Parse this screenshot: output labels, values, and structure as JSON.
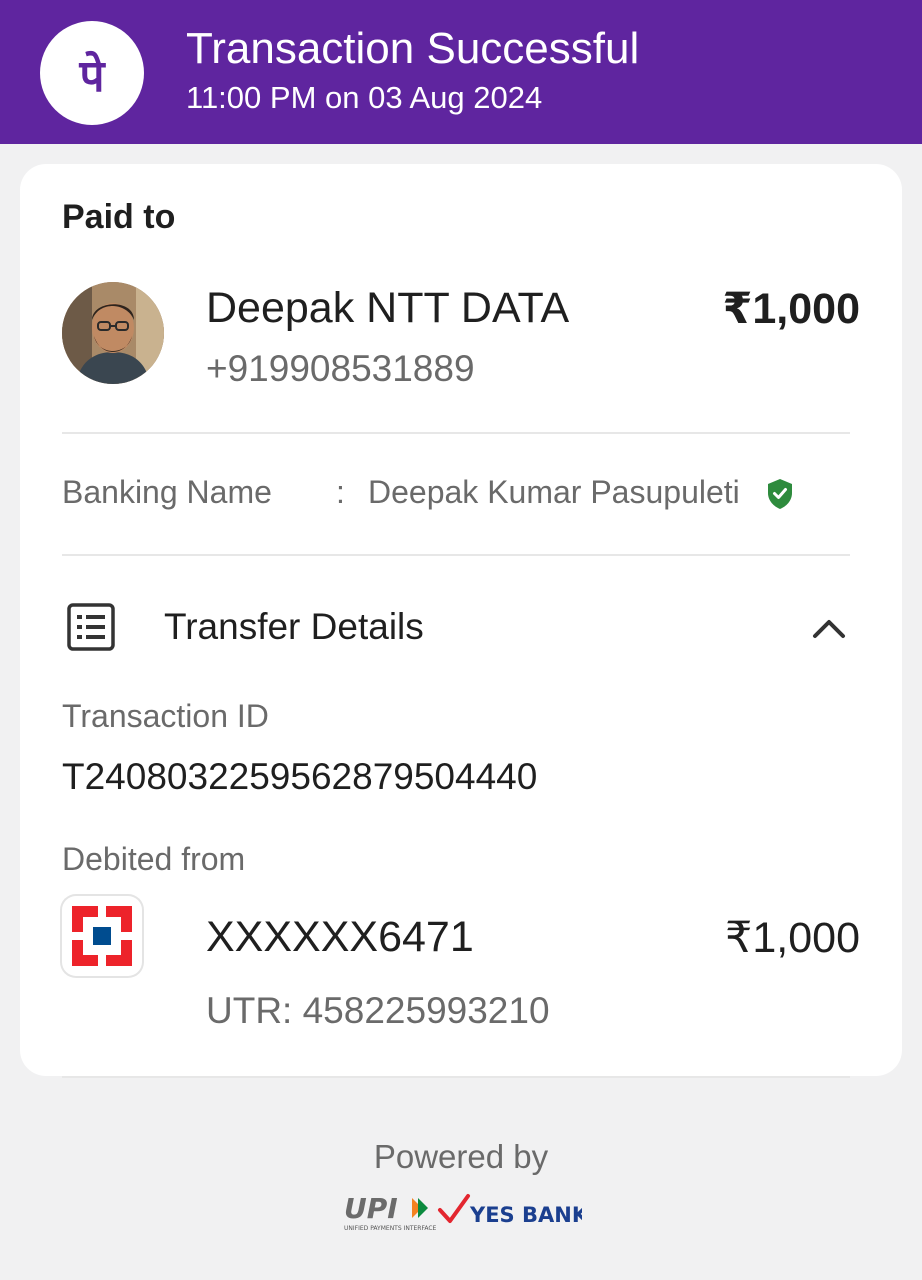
{
  "header": {
    "title": "Transaction Successful",
    "datetime": "11:00 PM on 03 Aug 2024",
    "brand_color": "#5f259f",
    "logo_glyph": "पे"
  },
  "payee": {
    "section_label": "Paid to",
    "name": "Deepak NTT DATA",
    "phone": "+919908531889",
    "amount": "₹1,000"
  },
  "banking": {
    "label": "Banking Name",
    "separator": ":",
    "value": "Deepak Kumar Pasupuleti",
    "verified_icon": "verified-shield-icon",
    "verified_color": "#2e8b3d"
  },
  "transfer": {
    "title": "Transfer Details",
    "icon": "receipt-list-icon",
    "toggle_icon": "chevron-up-icon",
    "transaction_id_label": "Transaction ID",
    "transaction_id": "T2408032259562879504440",
    "debited_from_label": "Debited from",
    "account": "XXXXXX6471",
    "amount": "₹1,000",
    "utr": "UTR: 458225993210",
    "bank_logo_icon": "hdfc-bank-logo"
  },
  "footer": {
    "powered_by": "Powered by",
    "upi_text": "UPI",
    "upi_subtext": "UNIFIED PAYMENTS INTERFACE",
    "bank_text": "YES BANK"
  }
}
